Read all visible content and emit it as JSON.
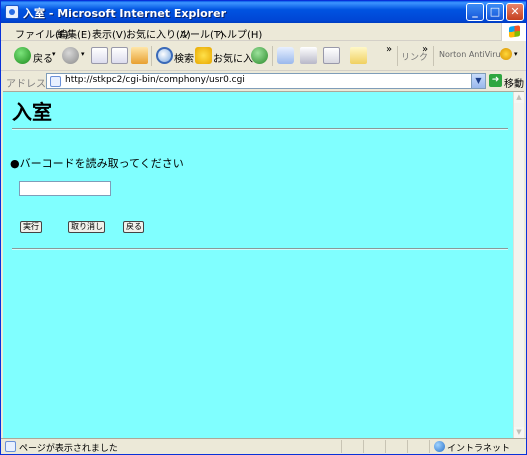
{
  "window": {
    "title": "入室 - Microsoft Internet Explorer",
    "min_symbol": "_",
    "max_symbol": "□",
    "close_symbol": "✕"
  },
  "menu": {
    "items": [
      "ファイル(F)",
      "編集(E)",
      "表示(V)",
      "お気に入り(A)",
      "ツール(T)",
      "ヘルプ(H)"
    ]
  },
  "toolbar": {
    "back_label": "戻る",
    "search_label": "検索",
    "favorites_label": "お気に入り",
    "more_symbol": "»",
    "links_label": "リンク",
    "norton_label": "Norton AntiVirus",
    "icons": [
      "back-icon",
      "forward-icon",
      "stop-icon",
      "refresh-icon",
      "home-icon",
      "search-icon",
      "favorites-icon",
      "history-icon",
      "mail-icon",
      "print-icon",
      "edit-icon",
      "messenger-icon",
      "norton-icon"
    ]
  },
  "address": {
    "label": "アドレス(D)",
    "url": "http://stkpc2/cgi-bin/comphony/usr0.cgi",
    "go_label": "移動"
  },
  "page": {
    "title": "入室",
    "prompt": "●バーコードを読み取ってください",
    "barcode_value": "",
    "buttons": {
      "run": "実行",
      "cancel": "取り消し",
      "back": "戻る"
    },
    "background_color": "#80ffff"
  },
  "status": {
    "text": "ページが表示されました",
    "zone": "イントラネット"
  }
}
